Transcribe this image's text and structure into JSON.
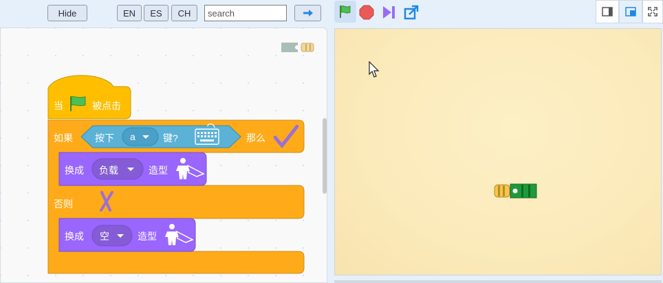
{
  "toolbar": {
    "hide_label": "Hide",
    "lang_en": "EN",
    "lang_es": "ES",
    "lang_ch": "CH",
    "search_placeholder": "search"
  },
  "icons": {
    "go": "arrow-right-icon",
    "flag": "green-flag-icon",
    "stop": "stop-icon",
    "turbo": "turbo-icon",
    "fullscreen": "expand-icon"
  },
  "script": {
    "hat_when": "当",
    "hat_clicked": "被点击",
    "if_label": "如果",
    "key_pressed_prefix": "按下",
    "key_value": "a",
    "key_pressed_suffix": "键?",
    "then_label": "那么",
    "switch_costume_1": "换成",
    "costume_1": "负载",
    "costume_suffix_1": "造型",
    "else_label": "否则",
    "switch_costume_2": "换成",
    "costume_2": "空",
    "costume_suffix_2": "造型"
  },
  "colors": {
    "events": "#ffbf00",
    "control": "#ffab19",
    "sensing": "#5cb1d6",
    "looks": "#9966ff",
    "stage_bg": "#fbeaba"
  }
}
